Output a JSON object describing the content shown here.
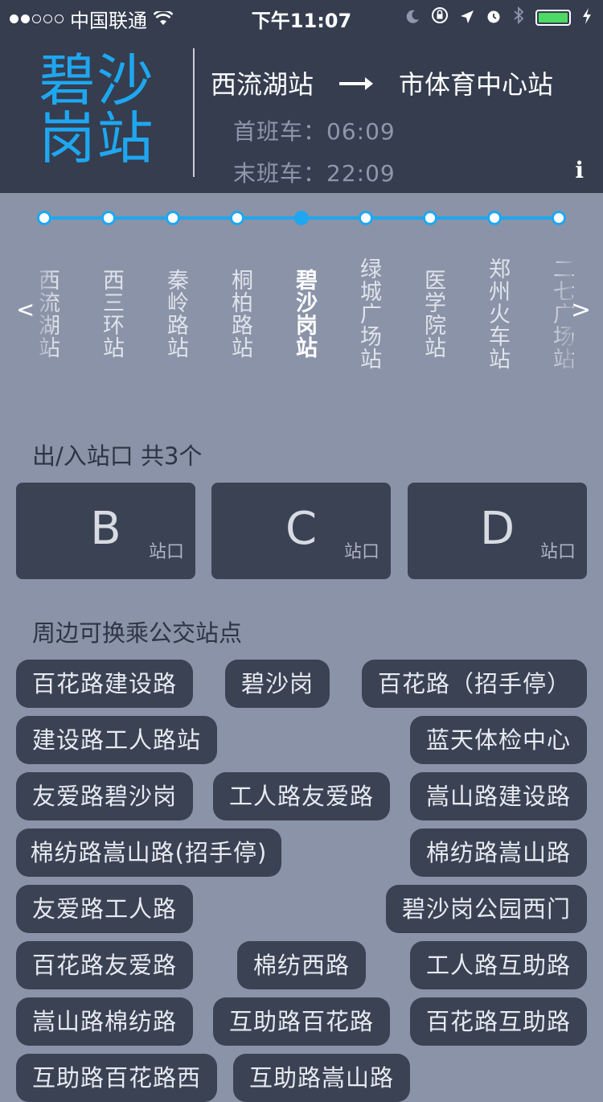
{
  "status_bar": {
    "carrier": "中国联通",
    "time": "下午11:07"
  },
  "header": {
    "station_name": "碧沙岗站",
    "route_from": "西流湖站",
    "route_to": "市体育中心站",
    "first_train": "首班车：06:09",
    "last_train": "末班车：22:09",
    "info_label": "i"
  },
  "line_map": {
    "stops": [
      {
        "name": "西流湖站",
        "current": false
      },
      {
        "name": "西三环站",
        "current": false
      },
      {
        "name": "秦岭路站",
        "current": false
      },
      {
        "name": "桐柏路站",
        "current": false
      },
      {
        "name": "碧沙岗站",
        "current": true
      },
      {
        "name": "绿城广场站",
        "current": false
      },
      {
        "name": "医学院站",
        "current": false
      },
      {
        "name": "郑州火车站",
        "current": false
      },
      {
        "name": "二七广场站",
        "current": false
      }
    ],
    "prev_label": "<",
    "next_label": ">",
    "line_color": "#1ea7f0"
  },
  "exits": {
    "title": "出/入站口 共3个",
    "suffix": "站口",
    "items": [
      "B",
      "C",
      "D"
    ]
  },
  "bus": {
    "title": "周边可换乘公交站点",
    "stops": [
      "百花路建设路",
      "碧沙岗",
      "百花路（招手停）",
      "建设路工人路站",
      "蓝天体检中心",
      "友爱路碧沙岗",
      "工人路友爱路",
      "嵩山路建设路",
      "棉纺路嵩山路(招手停)",
      "棉纺路嵩山路",
      "友爱路工人路",
      "碧沙岗公园西门",
      "百花路友爱路",
      "棉纺西路",
      "工人路互助路",
      "嵩山路棉纺路",
      "互助路百花路",
      "百花路互助路",
      "互助路百花路西",
      "互助路嵩山路"
    ]
  }
}
